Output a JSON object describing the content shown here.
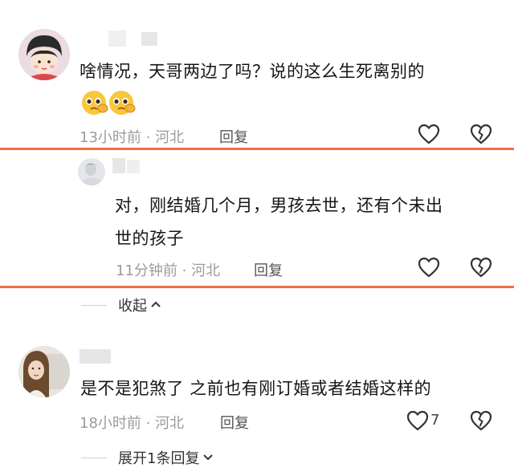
{
  "comments": [
    {
      "text": "啥情况，天哥两边了吗？说的这么生死离别的",
      "time_location": "13小时前 · 河北",
      "reply_label": "回复",
      "emoji": [
        "pleading-face",
        "pleading-face"
      ]
    },
    {
      "text_line1": "对，刚结婚几个月，男孩去世，还有个未出",
      "text_line2": "世的孩子",
      "time_location": "11分钟前 · 河北",
      "reply_label": "回复"
    },
    {
      "text": "是不是犯煞了 之前也有刚订婚或者结婚这样的",
      "time_location": "18小时前 · 河北",
      "reply_label": "回复",
      "like_count": "7"
    }
  ],
  "collapse_label": "收起",
  "expand_label": "展开1条回复",
  "colors": {
    "highlight": "#ec7045",
    "meta": "#9b9b9b"
  },
  "icons": [
    "heart-icon",
    "broken-heart-icon",
    "chevron-up-icon",
    "chevron-down-icon"
  ]
}
